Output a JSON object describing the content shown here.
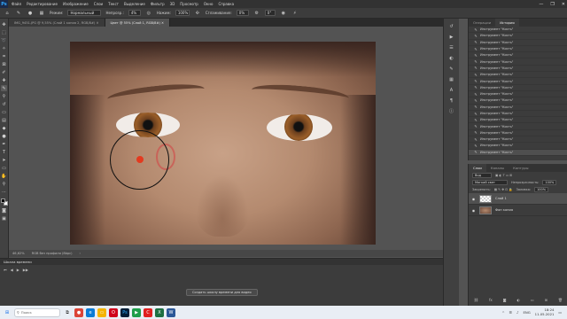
{
  "colors": {
    "accent": "#31a8ff",
    "brush_dot": "#e33a1f",
    "ui_dark": "#323232",
    "canvas_bg": "#535353"
  },
  "app": {
    "logo": "Ps"
  },
  "menubar": {
    "items": [
      "Файл",
      "Редактирование",
      "Изображение",
      "Слои",
      "Текст",
      "Выделение",
      "Фильтр",
      "3D",
      "Просмотр",
      "Окно",
      "Справка"
    ],
    "controls": [
      "—",
      "❐",
      "✕"
    ]
  },
  "options": {
    "mode_label": "Режим:",
    "mode_value": "Нормальный",
    "opacity_label": "Непрозр.:",
    "opacity_value": "4%",
    "flow_label": "Нажим:",
    "flow_value": "100%",
    "smoothing_label": "Сглаживание:",
    "smoothing_value": "0%",
    "angle_value": "0°"
  },
  "tabs": [
    {
      "label": "IMG_9451.JPG @ 9,55% (Слой 1 копия 2, RGB/8#) ✕",
      "active": false
    },
    {
      "label": "Цвет @ 55% (Слой 1, RGB/8#) ✕",
      "active": true
    }
  ],
  "statusbar": {
    "zoom": "46,62%",
    "profile": "RGB без профиля (8bpc)"
  },
  "timeline": {
    "title": "Шкала времени",
    "create_button": "Создать шкалу времени для видео"
  },
  "history_panel": {
    "tabs": [
      "Операции",
      "История"
    ],
    "items": [
      "Инструмент \"Кисть\"",
      "Инструмент \"Кисть\"",
      "Инструмент \"Кисть\"",
      "Инструмент \"Кисть\"",
      "Инструмент \"Кисть\"",
      "Инструмент \"Кисть\"",
      "Инструмент \"Кисть\"",
      "Инструмент \"Кисть\"",
      "Инструмент \"Кисть\"",
      "Инструмент \"Кисть\"",
      "Инструмент \"Кисть\"",
      "Инструмент \"Кисть\"",
      "Инструмент \"Кисть\"",
      "Инструмент \"Кисть\"",
      "Инструмент \"Кисть\"",
      "Инструмент \"Кисть\"",
      "Инструмент \"Кисть\"",
      "Инструмент \"Кисть\"",
      "Инструмент \"Кисть\"",
      "Инструмент \"Кисть\""
    ]
  },
  "layers_panel": {
    "tabs": [
      "Слои",
      "Каналы",
      "Контуры"
    ],
    "filter_label": "Вид",
    "blend_mode": "Мягкий свет",
    "opacity_label": "Непрозрачность:",
    "opacity_value": "100%",
    "lock_label": "Закрепить:",
    "fill_label": "Заливка:",
    "fill_value": "100%",
    "layers": [
      {
        "name": "Слой 1",
        "selected": true,
        "thumb": "empty"
      },
      {
        "name": "Фон копия",
        "selected": false,
        "thumb": "photo"
      }
    ]
  },
  "taskbar": {
    "search_placeholder": "Поиск",
    "lang": "ENG",
    "time": "18:24",
    "date": "11.05.2021"
  }
}
